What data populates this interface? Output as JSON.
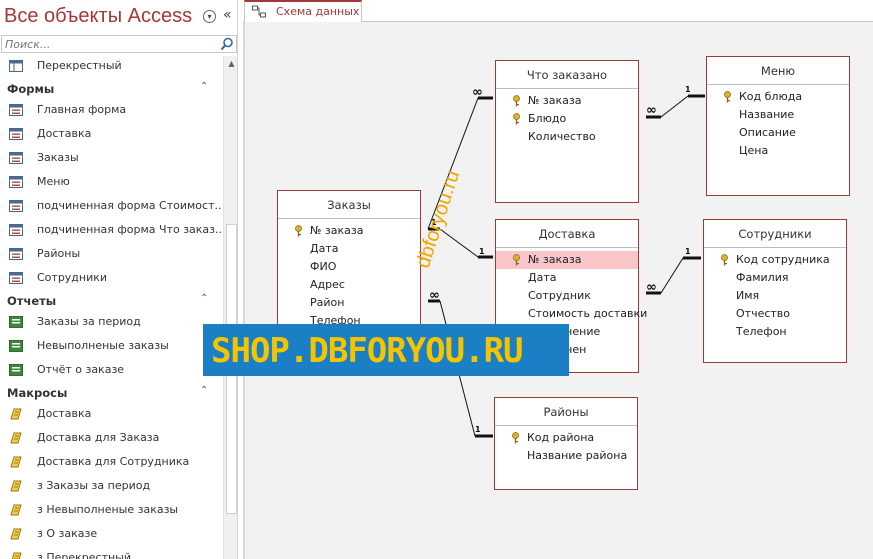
{
  "nav": {
    "title": "Все объекты Access",
    "search_placeholder": "Поиск...",
    "top_item": "Перекрестный",
    "groups": [
      {
        "label": "Формы",
        "items": [
          "Главная форма",
          "Доставка",
          "Заказы",
          "Меню",
          "подчиненная форма Стоимост...",
          "подчиненная форма Что заказ...",
          "Районы",
          "Сотрудники"
        ]
      },
      {
        "label": "Отчеты",
        "items": [
          "Заказы за период",
          "Невыполненые заказы",
          "Отчёт о заказе"
        ]
      },
      {
        "label": "Макросы",
        "items": [
          "Доставка",
          "Доставка для Заказа",
          "Доставка для Сотрудника",
          "з Заказы за период",
          "з Невыполненые заказы",
          "з О заказе",
          "з Перекрестный"
        ]
      }
    ]
  },
  "tab": {
    "label": "Схема данных"
  },
  "tables": {
    "zakazy": {
      "title": "Заказы",
      "fields": [
        "№ заказа",
        "Дата",
        "ФИО",
        "Адрес",
        "Район",
        "Телефон"
      ]
    },
    "chto": {
      "title": "Что заказано",
      "fields": [
        "№ заказа",
        "Блюдо",
        "Количество"
      ]
    },
    "menu": {
      "title": "Меню",
      "fields": [
        "Код блюда",
        "Название",
        "Описание",
        "Цена"
      ]
    },
    "dostavka": {
      "title": "Доставка",
      "fields": [
        "№ заказа",
        "Дата",
        "Сотрудник",
        "Стоимость доставки",
        "Выполнение",
        "Выполнен"
      ]
    },
    "sotr": {
      "title": "Сотрудники",
      "fields": [
        "Код сотрудника",
        "Фамилия",
        "Имя",
        "Отчество",
        "Телефон"
      ]
    },
    "rayony": {
      "title": "Районы",
      "fields": [
        "Код района",
        "Название района"
      ]
    }
  },
  "relations": {
    "one": "1",
    "many": "∞"
  },
  "watermark": {
    "diag": "dbforyou.ru",
    "banner": "SHOP.DBFORYOU.RU"
  },
  "colors": {
    "accent": "#a4373a",
    "banner_bg": "#1a7fc4",
    "banner_fg": "#f5c400",
    "selected_row": "#f8c6c8"
  }
}
